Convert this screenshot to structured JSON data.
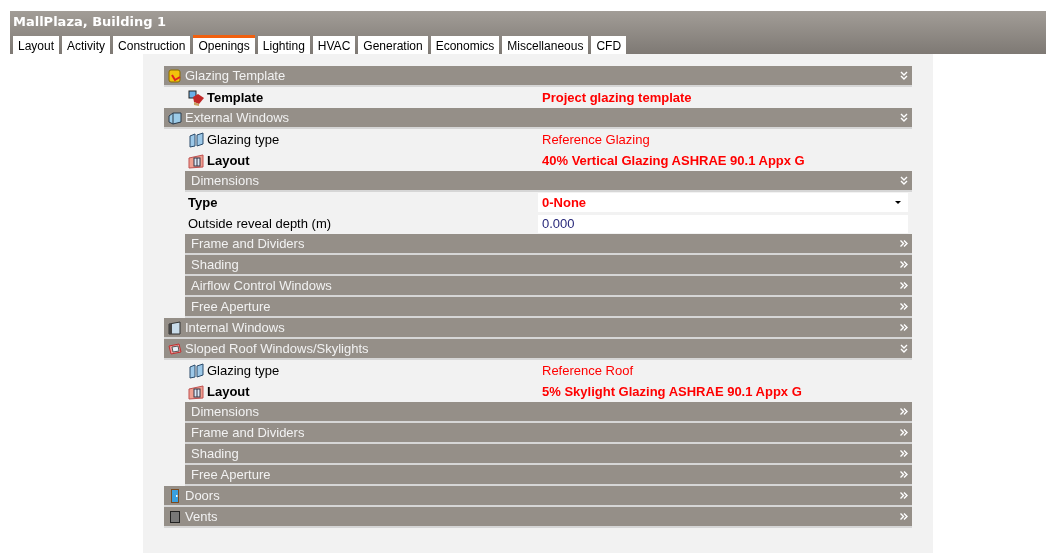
{
  "window": {
    "title": "MallPlaza, Building 1"
  },
  "tabs": [
    {
      "label": "Layout",
      "selected": false
    },
    {
      "label": "Activity",
      "selected": false
    },
    {
      "label": "Construction",
      "selected": false
    },
    {
      "label": "Openings",
      "selected": true
    },
    {
      "label": "Lighting",
      "selected": false
    },
    {
      "label": "HVAC",
      "selected": false
    },
    {
      "label": "Generation",
      "selected": false
    },
    {
      "label": "Economics",
      "selected": false
    },
    {
      "label": "Miscellaneous",
      "selected": false
    },
    {
      "label": "CFD",
      "selected": false
    }
  ],
  "sections": [
    {
      "kind": "template",
      "title": "Glazing Template",
      "expanded": true,
      "children": [
        {
          "kind": "template",
          "label": "Template",
          "bold": true,
          "value": "Project glazing template"
        }
      ]
    },
    {
      "kind": "external",
      "title": "External Windows",
      "expanded": true,
      "children": [
        {
          "kind": "glazing",
          "label": "Glazing type",
          "bold": false,
          "value": "Reference Glazing"
        },
        {
          "kind": "layout",
          "label": "Layout",
          "bold": true,
          "value": "40% Vertical Glazing ASHRAE 90.1 Appx G"
        },
        {
          "kind": "sub",
          "title": "Dimensions",
          "expanded": true,
          "children": [
            {
              "kind": "dropdown",
              "label": "Type",
              "bold": true,
              "value": "0-None"
            },
            {
              "kind": "input",
              "label": "Outside reveal depth (m)",
              "bold": false,
              "value": "0.000"
            }
          ]
        },
        {
          "kind": "sub",
          "title": "Frame and Dividers",
          "expanded": false
        },
        {
          "kind": "sub",
          "title": "Shading",
          "expanded": false
        },
        {
          "kind": "sub",
          "title": "Airflow Control Windows",
          "expanded": false
        },
        {
          "kind": "sub",
          "title": "Free Aperture",
          "expanded": false
        }
      ]
    },
    {
      "kind": "internal",
      "title": "Internal Windows",
      "expanded": false
    },
    {
      "kind": "roof",
      "title": "Sloped Roof Windows/Skylights",
      "expanded": true,
      "children": [
        {
          "kind": "glazing",
          "label": "Glazing type",
          "bold": false,
          "value": "Reference Roof"
        },
        {
          "kind": "layout",
          "label": "Layout",
          "bold": true,
          "value": "5% Skylight Glazing ASHRAE 90.1 Appx G"
        },
        {
          "kind": "sub",
          "title": "Dimensions",
          "expanded": false
        },
        {
          "kind": "sub",
          "title": "Frame and Dividers",
          "expanded": false
        },
        {
          "kind": "sub",
          "title": "Shading",
          "expanded": false
        },
        {
          "kind": "sub",
          "title": "Free Aperture",
          "expanded": false
        }
      ]
    },
    {
      "kind": "doors",
      "title": "Doors",
      "expanded": false
    },
    {
      "kind": "vents",
      "title": "Vents",
      "expanded": false
    }
  ]
}
